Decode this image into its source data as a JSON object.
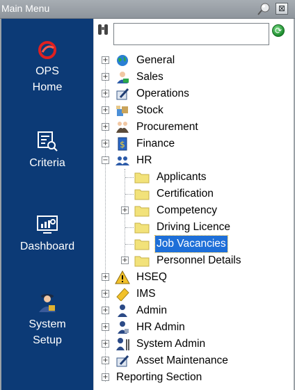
{
  "window": {
    "title": "Main Menu",
    "close_label": "⊠"
  },
  "nav": [
    {
      "label_line1": "OPS",
      "label_line2": "Home",
      "icon": "ops-logo-icon"
    },
    {
      "label_line1": "Criteria",
      "label_line2": "",
      "icon": "criteria-search-icon"
    },
    {
      "label_line1": "Dashboard",
      "label_line2": "",
      "icon": "dashboard-chart-icon"
    },
    {
      "label_line1": "System",
      "label_line2": "Setup",
      "icon": "security-guard-icon"
    }
  ],
  "search": {
    "value": "",
    "placeholder": ""
  },
  "tree": {
    "top": [
      {
        "label": "General",
        "icon": "globe-icon"
      },
      {
        "label": "Sales",
        "icon": "sales-person-icon"
      },
      {
        "label": "Operations",
        "icon": "operations-pen-icon"
      },
      {
        "label": "Stock",
        "icon": "stock-boxes-icon"
      },
      {
        "label": "Procurement",
        "icon": "procurement-handshake-icon"
      },
      {
        "label": "Finance",
        "icon": "finance-dollar-icon"
      },
      {
        "label": "HR",
        "icon": "hr-people-icon"
      }
    ],
    "hr_children": [
      {
        "label": "Applicants",
        "expandable": false
      },
      {
        "label": "Certification",
        "expandable": false
      },
      {
        "label": "Competency",
        "expandable": true
      },
      {
        "label": "Driving Licence",
        "expandable": false
      },
      {
        "label": "Job Vacancies",
        "expandable": false,
        "selected": true
      },
      {
        "label": "Personnel Details",
        "expandable": true
      }
    ],
    "bottom": [
      {
        "label": "HSEQ",
        "icon": "warning-triangle-icon"
      },
      {
        "label": "IMS",
        "icon": "ims-note-icon"
      },
      {
        "label": "Admin",
        "icon": "admin-person-icon"
      },
      {
        "label": "HR Admin",
        "icon": "hr-admin-person-icon"
      },
      {
        "label": "System Admin",
        "icon": "system-admin-tools-icon"
      },
      {
        "label": "Asset Maintenance",
        "icon": "asset-maintenance-pen-icon"
      },
      {
        "label": "Reporting Section",
        "icon": ""
      }
    ]
  },
  "colors": {
    "nav_bg": "#0c3a76",
    "selection": "#1e6fd8",
    "folder": "#f2e27a"
  }
}
